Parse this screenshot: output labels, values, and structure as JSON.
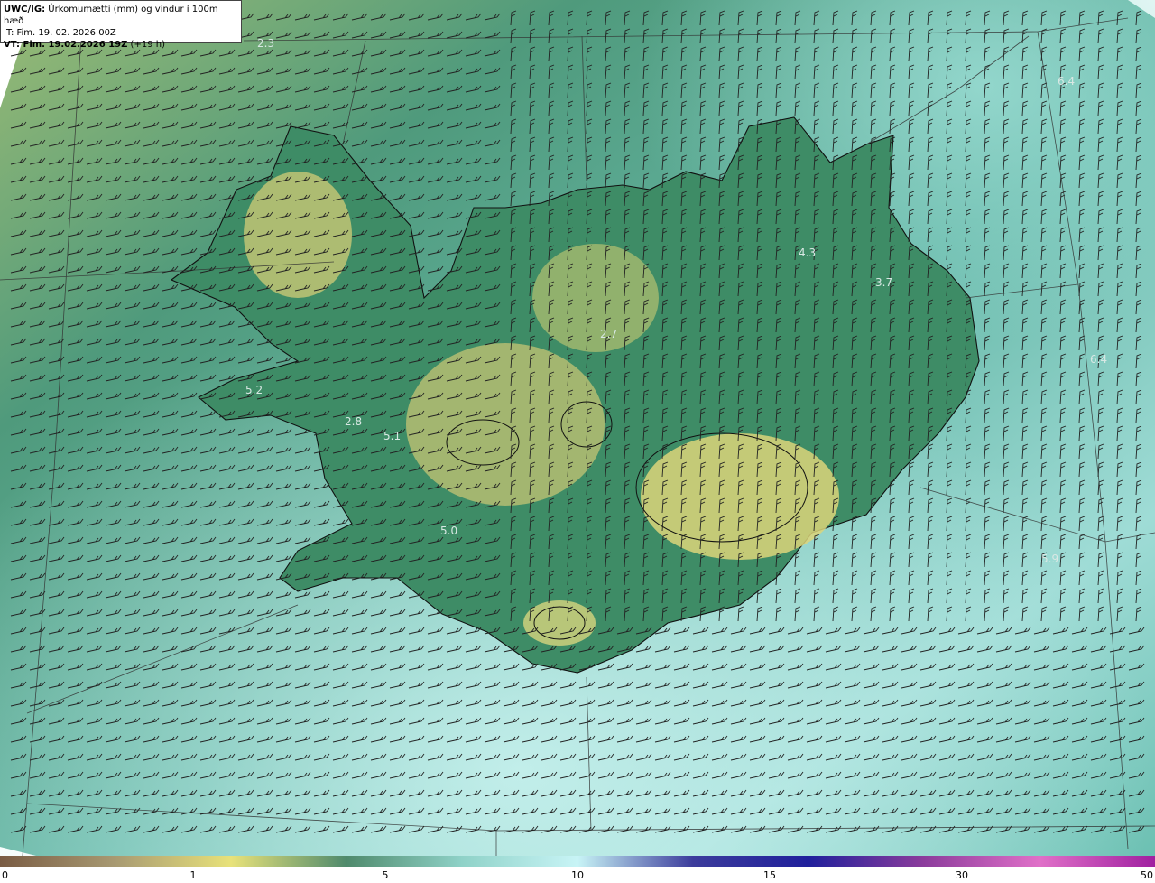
{
  "header": {
    "title_prefix": "UWC/IG:",
    "title_text": " Úrkomumætti (mm) og vindur í 100m hæð",
    "init_line": "IT: Fim. 19. 02. 2026 00Z",
    "valid_prefix": "VT: Fim. 19.02.2026 19Z",
    "valid_suffix": " (+19 h)"
  },
  "map_labels": [
    "2.3",
    "6.4",
    "4.3",
    "3.7",
    "2.7",
    "6.4",
    "5.2",
    "2.8",
    "5.1",
    "5.0",
    "5.9"
  ],
  "legend": {
    "ticks": [
      "0",
      "1",
      "5",
      "10",
      "15",
      "30",
      "50"
    ],
    "colors": [
      "#7a5c44",
      "#a89a72",
      "#e8e27a",
      "#4f8a6c",
      "#8fd2c8",
      "#c8f4f6",
      "#3c3c9c",
      "#20209c",
      "#8c3c9c",
      "#e070c8",
      "#a020a0"
    ]
  },
  "colors": {
    "ocean": "#5fb8aa",
    "land": "#3f8a62",
    "highland": "#d9d37c",
    "coast": "#111111"
  }
}
